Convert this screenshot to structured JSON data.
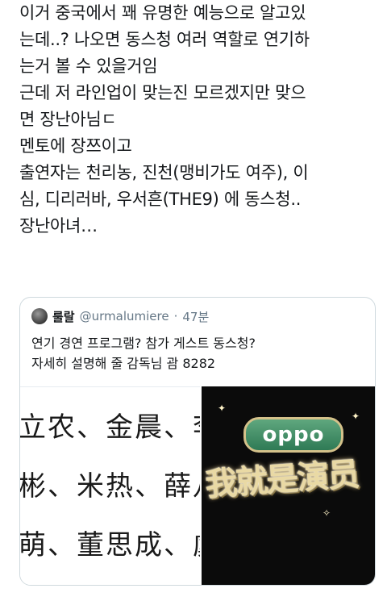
{
  "tweet": {
    "lines": [
      "이거 중국에서 꽤 유명한 예능으로 알고있",
      "는데..? 나오면 동스청 여러 역할로 연기하",
      "는거 볼 수 있을거임",
      "근데 저 라인업이 맞는진 모르겠지만 맞으",
      "면 장난아님ㄷ",
      "멘토에 장쯔이고",
      "출연자는 천리농, 진천(맹비가도 여주), 이",
      "심, 디리러바, 우서흔(THE9) 에 동스청..",
      "장난아녀…"
    ]
  },
  "quote": {
    "name": "룰랄",
    "handle": "@urmalumiere",
    "dot": "·",
    "time": "47분",
    "lines": [
      "연기 경연 프로그램? 참가 게스트 동스청?",
      "자세히 설명해 줄 감독님 괌 8282"
    ],
    "media": {
      "cast_lines": [
        "立农、金晨、李",
        "彬、米热、薛八",
        "萌、董思成、虞"
      ],
      "logo_text": "oppo",
      "show_title": "我就是演员"
    }
  },
  "colors": {
    "text": "#14171a",
    "secondary": "#657786",
    "border": "#cfd9de",
    "oppo_green": "#2f7a55",
    "title_gold": "#e9d9a4"
  },
  "icons": {
    "avatar": "user-avatar"
  }
}
